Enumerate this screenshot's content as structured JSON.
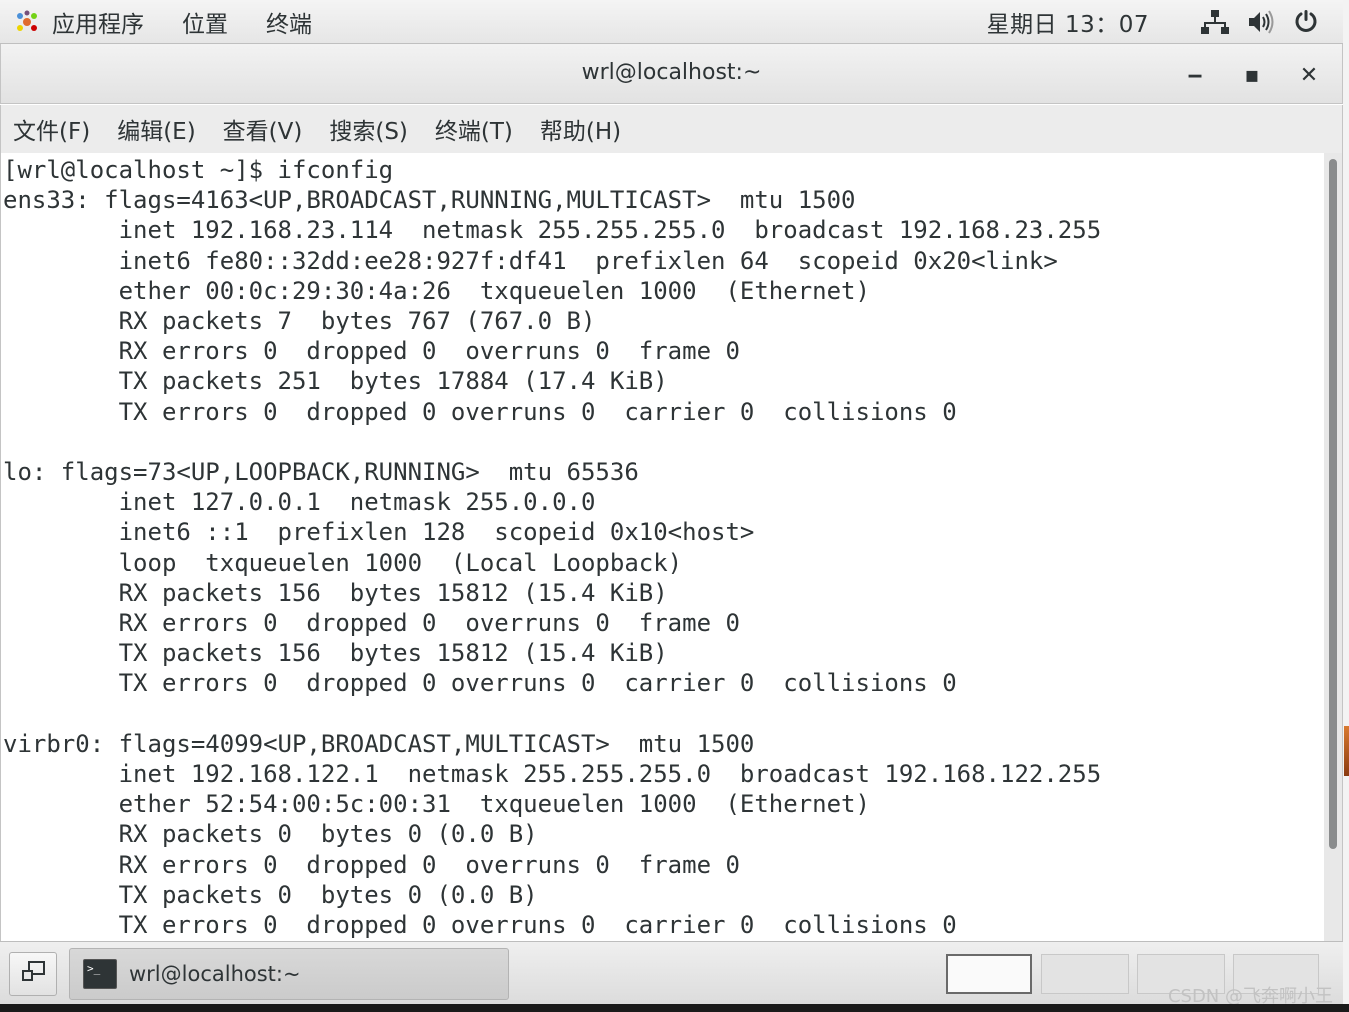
{
  "topbar": {
    "apps_label": "应用程序",
    "places_label": "位置",
    "app_name": "终端",
    "clock": "星期日 13：07",
    "icons": [
      "network-icon",
      "volume-icon",
      "power-icon"
    ]
  },
  "window": {
    "title": "wrl@localhost:~",
    "minimize_label": "‒",
    "maximize_label": "▪",
    "close_label": "✕"
  },
  "menubar": {
    "items": [
      {
        "label": "文件(F)"
      },
      {
        "label": "编辑(E)"
      },
      {
        "label": "查看(V)"
      },
      {
        "label": "搜索(S)"
      },
      {
        "label": "终端(T)"
      },
      {
        "label": "帮助(H)"
      }
    ]
  },
  "terminal": {
    "lines": [
      "[wrl@localhost ~]$ ifconfig",
      "ens33: flags=4163<UP,BROADCAST,RUNNING,MULTICAST>  mtu 1500",
      "        inet 192.168.23.114  netmask 255.255.255.0  broadcast 192.168.23.255",
      "        inet6 fe80::32dd:ee28:927f:df41  prefixlen 64  scopeid 0x20<link>",
      "        ether 00:0c:29:30:4a:26  txqueuelen 1000  (Ethernet)",
      "        RX packets 7  bytes 767 (767.0 B)",
      "        RX errors 0  dropped 0  overruns 0  frame 0",
      "        TX packets 251  bytes 17884 (17.4 KiB)",
      "        TX errors 0  dropped 0 overruns 0  carrier 0  collisions 0",
      "",
      "lo: flags=73<UP,LOOPBACK,RUNNING>  mtu 65536",
      "        inet 127.0.0.1  netmask 255.0.0.0",
      "        inet6 ::1  prefixlen 128  scopeid 0x10<host>",
      "        loop  txqueuelen 1000  (Local Loopback)",
      "        RX packets 156  bytes 15812 (15.4 KiB)",
      "        RX errors 0  dropped 0  overruns 0  frame 0",
      "        TX packets 156  bytes 15812 (15.4 KiB)",
      "        TX errors 0  dropped 0 overruns 0  carrier 0  collisions 0",
      "",
      "virbr0: flags=4099<UP,BROADCAST,MULTICAST>  mtu 1500",
      "        inet 192.168.122.1  netmask 255.255.255.0  broadcast 192.168.122.255",
      "        ether 52:54:00:5c:00:31  txqueuelen 1000  (Ethernet)",
      "        RX packets 0  bytes 0 (0.0 B)",
      "        RX errors 0  dropped 0  overruns 0  frame 0",
      "        TX packets 0  bytes 0 (0.0 B)",
      "        TX errors 0  dropped 0 overruns 0  carrier 0  collisions 0"
    ]
  },
  "taskbar": {
    "window_button_label": "wrl@localhost:~",
    "watermark": "CSDN @飞奔啊小王"
  },
  "colors": {
    "terminal_bg": "#ffffff",
    "terminal_fg": "#2e3436",
    "chrome_bg": "#e6e6e6"
  }
}
